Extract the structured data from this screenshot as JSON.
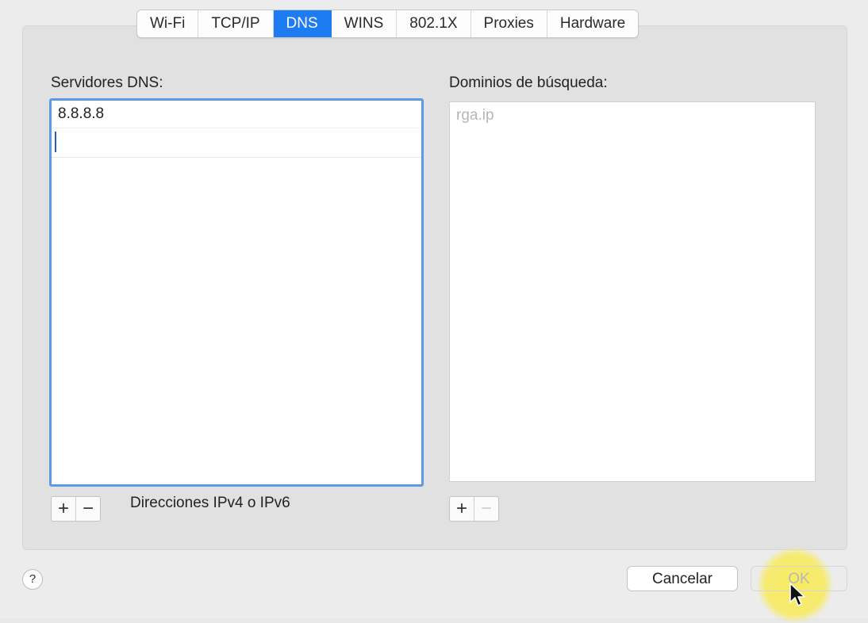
{
  "tabs": [
    {
      "label": "Wi-Fi",
      "active": false
    },
    {
      "label": "TCP/IP",
      "active": false
    },
    {
      "label": "DNS",
      "active": true
    },
    {
      "label": "WINS",
      "active": false
    },
    {
      "label": "802.1X",
      "active": false
    },
    {
      "label": "Proxies",
      "active": false
    },
    {
      "label": "Hardware",
      "active": false
    }
  ],
  "dns": {
    "label": "Servidores DNS:",
    "servers": [
      "8.8.8.8"
    ],
    "hint": "Direcciones IPv4 o IPv6"
  },
  "domains": {
    "label": "Dominios de búsqueda:",
    "placeholder": "rga.ip"
  },
  "controls": {
    "plus": "+",
    "minus": "−"
  },
  "footer": {
    "help": "?",
    "cancel": "Cancelar",
    "ok": "OK"
  },
  "colors": {
    "accent": "#1e7cf2",
    "focus_ring": "#5c9ae6",
    "highlight": "#f8eb5a"
  }
}
